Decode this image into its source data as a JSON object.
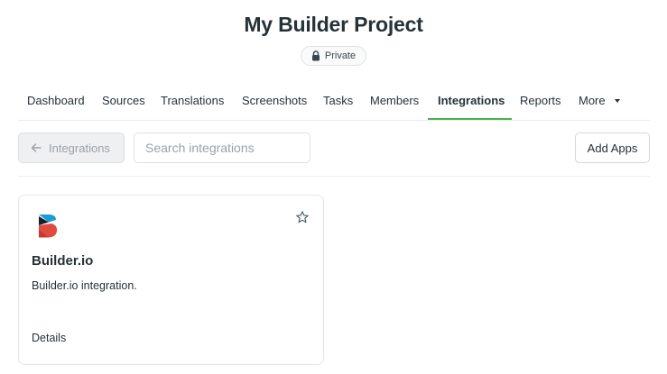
{
  "header": {
    "title": "My Builder Project",
    "privacy": "Private",
    "privacy_icon": "lock-icon"
  },
  "nav": {
    "items": [
      {
        "label": "Dashboard"
      },
      {
        "label": "Sources"
      },
      {
        "label": "Translations"
      },
      {
        "label": "Screenshots"
      },
      {
        "label": "Tasks"
      },
      {
        "label": "Members"
      },
      {
        "label": "Integrations",
        "active": true
      },
      {
        "label": "Reports"
      },
      {
        "label": "More",
        "icon": "caret-down-icon"
      }
    ],
    "active_color": "#4caf50"
  },
  "toolbar": {
    "back_label": "Integrations",
    "back_icon": "arrow-left-icon",
    "search_placeholder": "Search integrations",
    "search_value": "",
    "add_apps_label": "Add Apps"
  },
  "integrations": [
    {
      "title": "Builder.io",
      "description": "Builder.io integration.",
      "link_label": "Details",
      "logo_icon": "builder-logo-icon",
      "favorite_icon": "star-outline-icon",
      "brand_colors": [
        "#1b9bd7",
        "#e04a3f",
        "#18202a"
      ]
    }
  ]
}
